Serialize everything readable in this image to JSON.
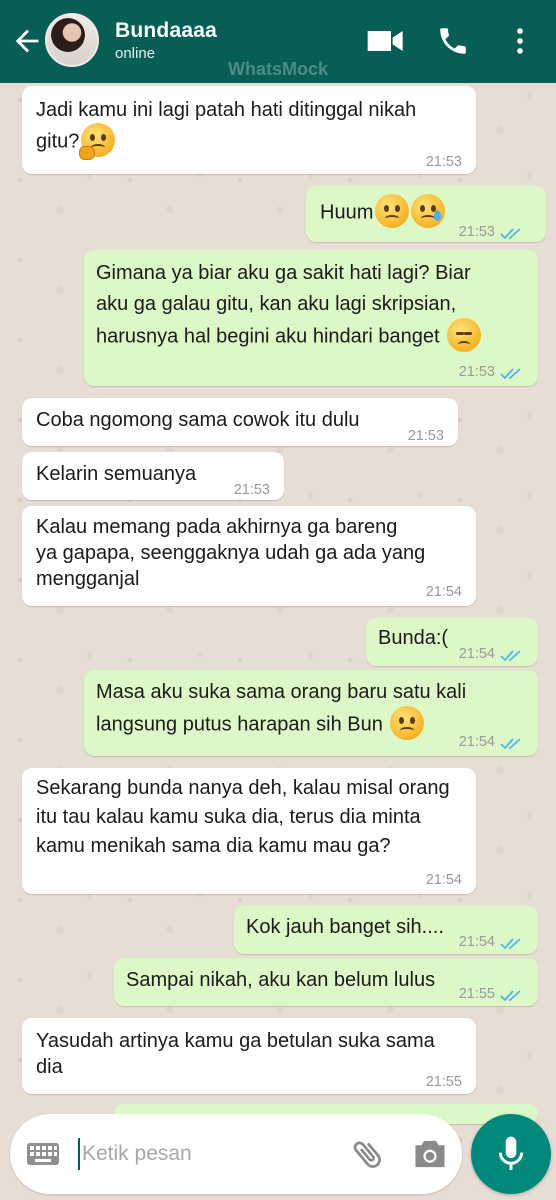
{
  "header": {
    "contact_name": "Bundaaaa",
    "status": "online",
    "watermark": "WhatsMock",
    "icons": [
      "back-arrow-icon",
      "avatar",
      "video-call-icon",
      "phone-icon",
      "more-vert-icon"
    ]
  },
  "messages": [
    {
      "direction": "in",
      "text": "Jadi kamu ini lagi patah hati ditinggal nikah\ngitu?",
      "emoji": "thinking-face",
      "time": "21:53"
    },
    {
      "direction": "out",
      "text": "Huum",
      "emoji": "frowning-face, crying-face",
      "time": "21:53",
      "status": "read"
    },
    {
      "direction": "out",
      "text": "Gimana ya biar aku ga sakit hati lagi? Biar\naku ga galau gitu, kan aku lagi skripsian,\nharusnya hal begini aku hindari banget",
      "emoji": "pensive-face",
      "time": "21:53",
      "status": "read"
    },
    {
      "direction": "in",
      "text": "Coba ngomong sama cowok itu dulu",
      "time": "21:53"
    },
    {
      "direction": "in",
      "text": "Kelarin semuanya",
      "time": "21:53"
    },
    {
      "direction": "in",
      "text": "Kalau memang pada akhirnya ga bareng\nya gapapa, seenggaknya udah ga ada yang\nmengganjal",
      "time": "21:54"
    },
    {
      "direction": "out",
      "text": "Bunda:(",
      "time": "21:54",
      "status": "read"
    },
    {
      "direction": "out",
      "text": "Masa aku suka sama orang baru satu kali\nlangsung putus harapan sih Bun",
      "emoji": "frowning-face",
      "time": "21:54",
      "status": "read"
    },
    {
      "direction": "in",
      "text": "Sekarang bunda nanya deh, kalau misal orang\nitu tau kalau kamu suka dia, terus dia minta\nkamu menikah sama dia kamu mau ga?",
      "time": "21:54"
    },
    {
      "direction": "out",
      "text": "Kok jauh banget sih....",
      "time": "21:54",
      "status": "read"
    },
    {
      "direction": "out",
      "text": "Sampai nikah, aku kan belum lulus",
      "time": "21:55",
      "status": "read"
    },
    {
      "direction": "in",
      "text": "Yasudah artinya kamu ga betulan suka sama\ndia",
      "time": "21:55"
    }
  ],
  "input": {
    "placeholder": "Ketik pesan",
    "value": ""
  },
  "colors": {
    "header": "#075e55",
    "outgoing_bubble": "#dcf8c6",
    "incoming_bubble": "#ffffff",
    "read_ticks": "#4fb6ec",
    "mic_button": "#00897b",
    "wallpaper": "#e6ddd4"
  }
}
